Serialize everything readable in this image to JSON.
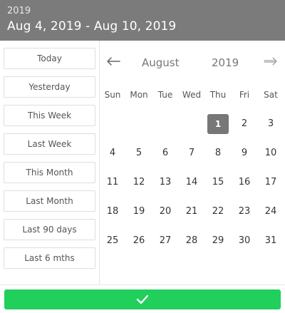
{
  "header": {
    "year": "2019",
    "range": "Aug 4, 2019 - Aug 10, 2019"
  },
  "presets": [
    "Today",
    "Yesterday",
    "This Week",
    "Last Week",
    "This Month",
    "Last Month",
    "Last 90 days",
    "Last 6 mths"
  ],
  "calendar": {
    "month": "August",
    "year": "2019",
    "prev_icon": "arrow-left-icon",
    "next_icon": "arrow-right-icon",
    "weekdays": [
      "Sun",
      "Mon",
      "Tue",
      "Wed",
      "Thu",
      "Fri",
      "Sat"
    ],
    "selected_day": "1",
    "weeks": [
      [
        "",
        "",
        "",
        "",
        "1",
        "2",
        "3"
      ],
      [
        "4",
        "5",
        "6",
        "7",
        "8",
        "9",
        "10"
      ],
      [
        "11",
        "12",
        "13",
        "14",
        "15",
        "16",
        "17"
      ],
      [
        "18",
        "19",
        "20",
        "21",
        "22",
        "23",
        "24"
      ],
      [
        "25",
        "26",
        "27",
        "28",
        "29",
        "30",
        "31"
      ]
    ]
  },
  "footer": {
    "confirm_icon": "checkmark-icon",
    "confirm_color": "#21cf5b"
  },
  "colors": {
    "header_bg": "#7b7b7b",
    "selected_day_bg": "#777777"
  }
}
